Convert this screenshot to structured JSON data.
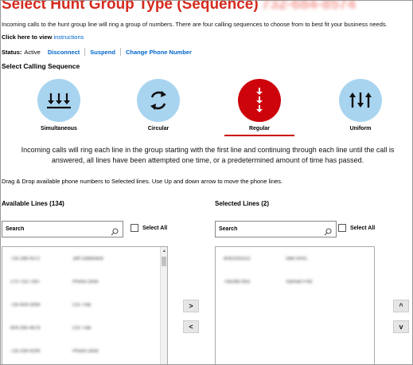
{
  "header": {
    "title": "Select Hunt Group Type (Sequence)",
    "phone": "732-684-8574"
  },
  "description": "Incoming calls to the hunt group line will ring a group of numbers. There are four calling sequences to choose from to best fit your business needs.",
  "instructions": {
    "prefix": "Click here to view ",
    "link": "instructions"
  },
  "status": {
    "label": "Status:",
    "value": "Active",
    "actions": [
      "Disconnect",
      "Suspend",
      "Change Phone Number"
    ]
  },
  "calling_sequence": {
    "heading": "Select Calling Sequence",
    "options": [
      {
        "label": "Simultaneous",
        "icon": "simultaneous-arrows-icon",
        "selected": false
      },
      {
        "label": "Circular",
        "icon": "circular-arrows-icon",
        "selected": false
      },
      {
        "label": "Regular",
        "icon": "regular-down-arrows-icon",
        "selected": true
      },
      {
        "label": "Uniform",
        "icon": "uniform-arrows-icon",
        "selected": false
      }
    ],
    "explanation": "Incoming calls will ring each line in the group starting with the first line and continuing through each line until the call is answered, all lines have been attempted one time, or a predetermined amount of time has passed."
  },
  "drag_drop_hint": "Drag & Drop available phone numbers to Selected lines. Use Up and down arrow to move the phone lines.",
  "available_lines": {
    "heading": "Available Lines (134)",
    "search_placeholder": "Search",
    "select_all_label": "Select All",
    "rows": [
      {
        "number": "716-286-4372",
        "name": "Jeff Gillebrand"
      },
      {
        "number": "270-753-7567",
        "name": "Phone Desk"
      },
      {
        "number": "716-404-5908",
        "name": "CIS Trak"
      },
      {
        "number": "804-395-4878",
        "name": "CIS Trak"
      },
      {
        "number": "716-208-4206",
        "name": "Phone Desk"
      }
    ]
  },
  "selected_lines": {
    "heading": "Selected Lines (2)",
    "search_placeholder": "Search",
    "select_all_label": "Select All",
    "rows": [
      {
        "number": "8042505523",
        "name": "Allie Arms"
      },
      {
        "number": "7562687855",
        "name": "Samuel Fritz"
      }
    ]
  },
  "transfer_buttons": {
    "add": ">",
    "remove": "<"
  },
  "order_buttons": {
    "up": "^",
    "down": "v"
  },
  "colors": {
    "brand_red": "#cd040b",
    "title_red": "#d52b1e",
    "link_blue": "#0066cc",
    "circle_blue": "#a8d4f0"
  }
}
